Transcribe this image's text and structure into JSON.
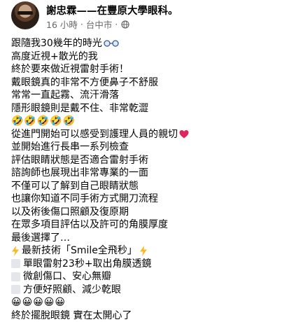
{
  "post": {
    "author": "謝忠霖——在豐原大學眼科。",
    "time": "16 小時",
    "location": "台中市",
    "lines": [
      "跟隨我30幾年的時光",
      "高度近視+散光的我",
      "終於要來做近視雷射手術！",
      "戴眼鏡真的非常不方便鼻子不舒服",
      "常常一直起霧、流汗滑落",
      "隱形眼鏡則是戴不住、非常乾澀",
      "🤣🤣🤣🤣🤣",
      "從進門開始可以感受到護理人員的親切",
      "並開始進行長串一系列檢查",
      "評估眼睛狀態是否適合雷射手術",
      "諮詢師也展現出非常專業的一面",
      "不僅可以了解到自己眼睛狀態",
      "也讓你知道不同手術方式開刀流程",
      "以及術後傷口照顧及復原期",
      "在眾多項目評估以及許可的角膜厚度",
      "最後選擇了…",
      "最新技術「Smile全飛秒」",
      "單眼雷射23秒+取出角膜透鏡",
      "微創傷口、安心無瓣",
      "方便好照顧、減少乾眼",
      "😀😀😀😀😀",
      "終於擺脫眼鏡 實在太開心了"
    ]
  },
  "icons": {
    "glasses": "glasses-emoji",
    "heart": "heart-icon",
    "bolt": "lightning-icon",
    "globe": "globe-icon",
    "square": "white-square-icon"
  }
}
